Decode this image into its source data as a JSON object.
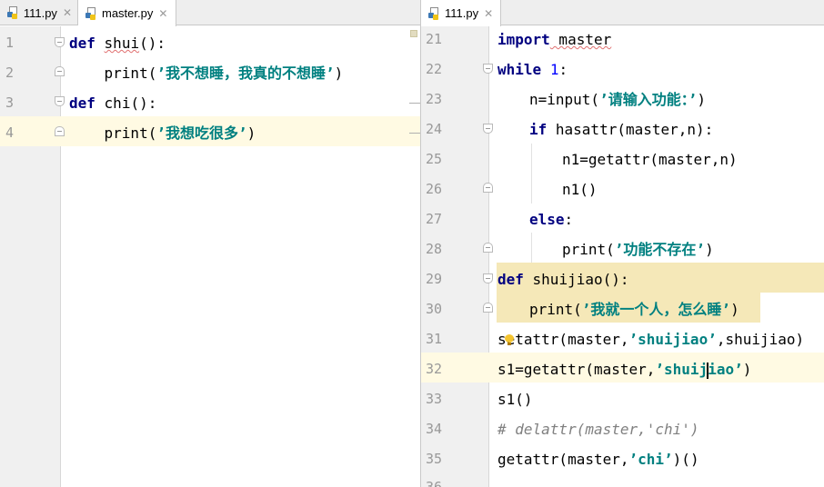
{
  "left_tabs": [
    {
      "label": "111.py",
      "active": false
    },
    {
      "label": "master.py",
      "active": true
    }
  ],
  "right_tabs": [
    {
      "label": "111.py",
      "active": true
    }
  ],
  "close_glyph": "✕",
  "left_editor": {
    "file": "master.py",
    "line_numbers": [
      "1",
      "2",
      "3",
      "4"
    ],
    "current_line": "4",
    "code": {
      "l1_kw": "def",
      "l1_name": "shui",
      "l1_rest": "():",
      "l2_indent": "    ",
      "l2_fn": "print(",
      "l2_str": "’我不想睡，我真的不想睡’",
      "l2_end": ")",
      "l3_kw": "def",
      "l3_name": "chi",
      "l3_rest": "():",
      "l4_indent": "    ",
      "l4_fn": "print(",
      "l4_str": "’我想吃很多’",
      "l4_end": ")"
    }
  },
  "right_editor": {
    "file": "111.py",
    "line_numbers": [
      "21",
      "22",
      "23",
      "24",
      "25",
      "26",
      "27",
      "28",
      "29",
      "30",
      "31",
      "32",
      "33",
      "34",
      "35",
      "36"
    ],
    "current_line": "32",
    "code": {
      "l21_kw": "import",
      "l21_rest": " master",
      "l22_kw": "while",
      "l22_num": "1",
      "l22_end": ":",
      "l23_a": "n=input(",
      "l23_str": "’请输入功能：’",
      "l23_end": ")",
      "l24_kw": "if",
      "l24_rest": " hasattr(master,n):",
      "l25_a": "n1=getattr(master,n)",
      "l26_a": "n1()",
      "l27_kw": "else",
      "l27_end": ":",
      "l28_a": "print(",
      "l28_str": "’功能不存在’",
      "l28_end": ")",
      "l29_kw": "def",
      "l29_rest": " shuijiao():",
      "l30_a": "print(",
      "l30_str": "’我就一个人，怎么睡’",
      "l30_end": ")",
      "l31_a": "setattr(master,",
      "l31_str": "’shuijiao’",
      "l31_end": ",shuijiao)",
      "l32_a": "s1=getattr(master,",
      "l32_str1": "’shuij",
      "l32_str2": "iao’",
      "l32_end": ")",
      "l33_a": "s1()",
      "l34_cmt": "# delattr(master,'chi')",
      "l35_a": "getattr(master,",
      "l35_str": "’chi’",
      "l35_end": ")()"
    }
  },
  "colors": {
    "keyword": "#000080",
    "string": "#008080",
    "number": "#0000ff",
    "comment": "#808080",
    "current_line": "#fffae3",
    "highlight_block": "#f5e8b8",
    "gutter": "#f0f0f0"
  },
  "icons": {
    "file_icon": "python-file-icon",
    "fold_marker": "fold-marker-icon",
    "intention": "lightbulb-icon"
  }
}
